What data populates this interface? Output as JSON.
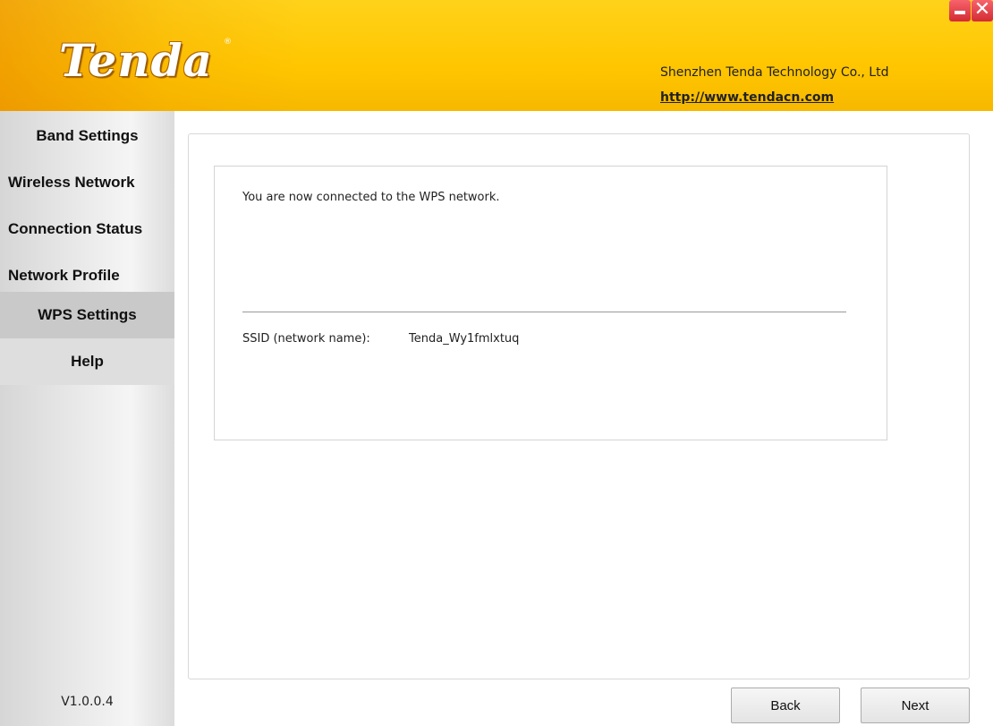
{
  "header": {
    "logo_text": "Tenda",
    "logo_mark": "®",
    "company": "Shenzhen Tenda Technology Co., Ltd",
    "website": "http://www.tendacn.com",
    "brand_color": "#ffc600"
  },
  "window_controls": {
    "minimize_icon": "minimize-icon",
    "close_icon": "close-icon",
    "close_glyph": "✕"
  },
  "sidebar": {
    "items": [
      {
        "label": "Band Settings",
        "active": false
      },
      {
        "label": "Wireless Network",
        "active": false
      },
      {
        "label": "Connection Status",
        "active": false
      },
      {
        "label": "Network Profile",
        "active": false
      },
      {
        "label": "WPS Settings",
        "active": true
      },
      {
        "label": "Help",
        "active": false
      }
    ],
    "version": "V1.0.0.4"
  },
  "main": {
    "message": "You are now connected to the WPS network.",
    "ssid_label": "SSID (network name):",
    "ssid_value": "Tenda_Wy1fmlxtuq"
  },
  "footer": {
    "back_label": "Back",
    "next_label": "Next"
  }
}
